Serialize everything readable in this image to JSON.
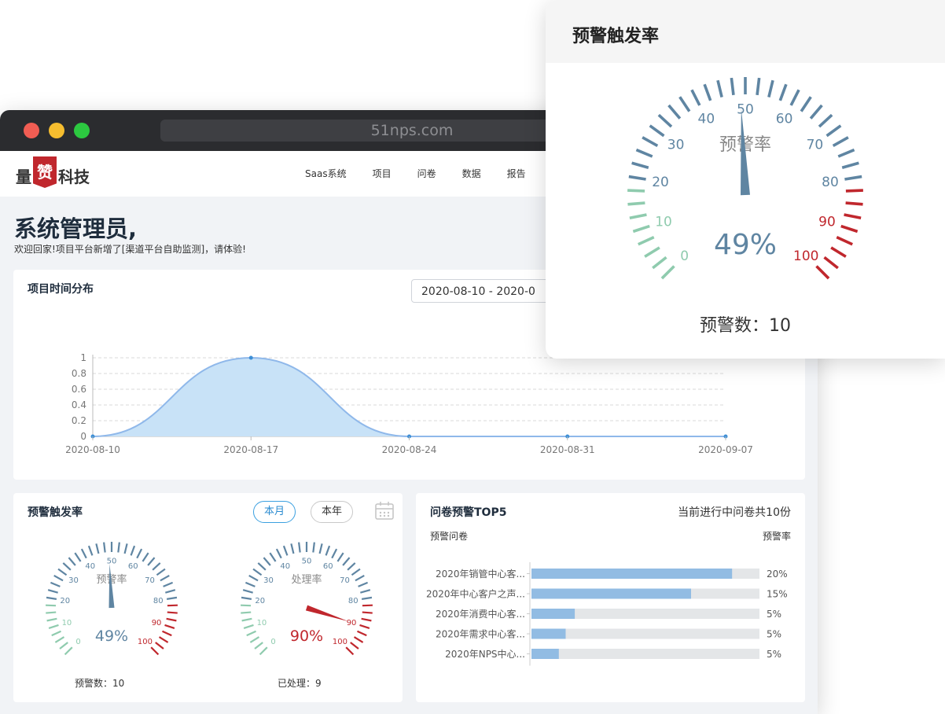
{
  "browser": {
    "url": "51nps.com",
    "window_dots": [
      "#f15d53",
      "#f6bd2f",
      "#2cc840"
    ]
  },
  "nav": {
    "logo_parts": [
      "量",
      "赞",
      "科技"
    ],
    "items": [
      "Saas系统",
      "项目",
      "问卷",
      "数据",
      "报告"
    ]
  },
  "welcome": {
    "title": "系统管理员,",
    "subtitle": "欢迎回家!项目平台新增了[渠道平台自助监测]，请体验!"
  },
  "project_chart": {
    "title": "项目时间分布",
    "date_range": "2020-08-10 - 2020-0"
  },
  "chart_data": {
    "type": "area",
    "x": [
      "2020-08-10",
      "2020-08-17",
      "2020-08-24",
      "2020-08-31",
      "2020-09-07"
    ],
    "values": [
      0,
      1,
      0,
      0,
      0
    ],
    "yticks": [
      "0",
      "0.2",
      "0.4",
      "0.6",
      "0.8",
      "1"
    ],
    "ylim": [
      0,
      1
    ],
    "grid": true,
    "color": "#8fb8ea",
    "fill": "#c8e2f7"
  },
  "alert_card": {
    "title": "预警触发率",
    "toggle_month": "本月",
    "toggle_year": "本年",
    "calendar_icon": "calendar-icon",
    "gauge1": {
      "label": "预警率",
      "value": 49,
      "display": "49%",
      "caption": "预警数：10",
      "value_color": "#5f85a2"
    },
    "gauge2": {
      "label": "处理率",
      "value": 90,
      "display": "90%",
      "caption": "已处理：9",
      "value_color": "#c0272d"
    },
    "tick_labels": [
      "0",
      "10",
      "20",
      "30",
      "40",
      "50",
      "60",
      "70",
      "80",
      "90",
      "100"
    ]
  },
  "top5": {
    "title": "问卷预警TOP5",
    "summary": "当前进行中问卷共10份",
    "col_left": "预警问卷",
    "col_right": "预警率",
    "rows": [
      {
        "name": "2020年销管中心客...",
        "pct": 88,
        "label": "20%"
      },
      {
        "name": "2020年中心客户之声...",
        "pct": 70,
        "label": "15%"
      },
      {
        "name": "2020年消费中心客...",
        "pct": 19,
        "label": "5%"
      },
      {
        "name": "2020年需求中心客...",
        "pct": 15,
        "label": "5%"
      },
      {
        "name": "2020年NPS中心...",
        "pct": 12,
        "label": "5%"
      }
    ],
    "bar_color": "#92bce3",
    "track_color": "#e4e6e8"
  },
  "popup": {
    "title": "预警触发率",
    "gauge_label": "预警率",
    "value": 49,
    "display": "49%",
    "caption": "预警数：10"
  },
  "colors": {
    "green": "#8fcbae",
    "blue": "#5f85a2",
    "red": "#c0272d"
  }
}
